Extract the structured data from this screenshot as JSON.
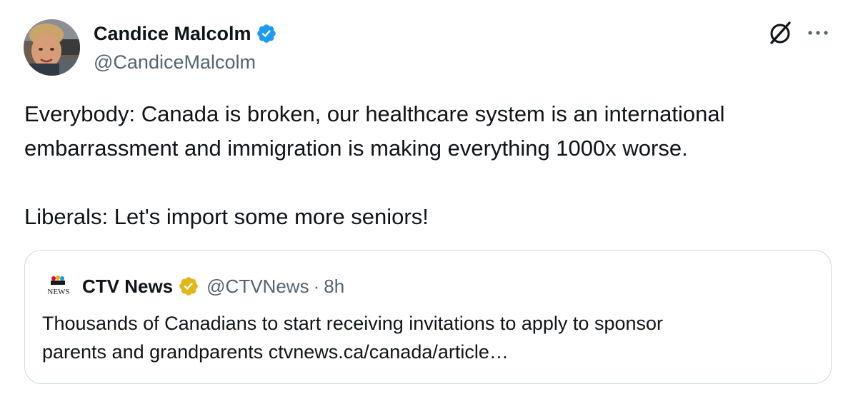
{
  "author": {
    "display_name": "Candice Malcolm",
    "handle": "@CandiceMalcolm",
    "verified_icon": "verified-badge-blue",
    "verified_color": "#1d9bf0"
  },
  "header_actions": {
    "grok_icon": "grok-icon",
    "more_icon": "more-options-icon"
  },
  "tweet": {
    "line1": "Everybody: Canada is broken, our healthcare system is an international",
    "line2": "embarrassment and immigration is making everything 1000x worse.",
    "line3": "Liberals: Let's import some more seniors!"
  },
  "quote": {
    "logo_icon": "ctv-news-logo",
    "display_name": "CTV News",
    "verified_icon": "verified-badge-gold",
    "verified_color": "#e2b719",
    "handle": "@CTVNews",
    "separator": "·",
    "time": "8h",
    "text_line1": "Thousands of Canadians to start receiving invitations to apply to sponsor",
    "text_line2": "parents and grandparents ctvnews.ca/canada/article…"
  },
  "colors": {
    "text_primary": "#0f1419",
    "text_secondary": "#536471",
    "border": "#cfd9de"
  }
}
